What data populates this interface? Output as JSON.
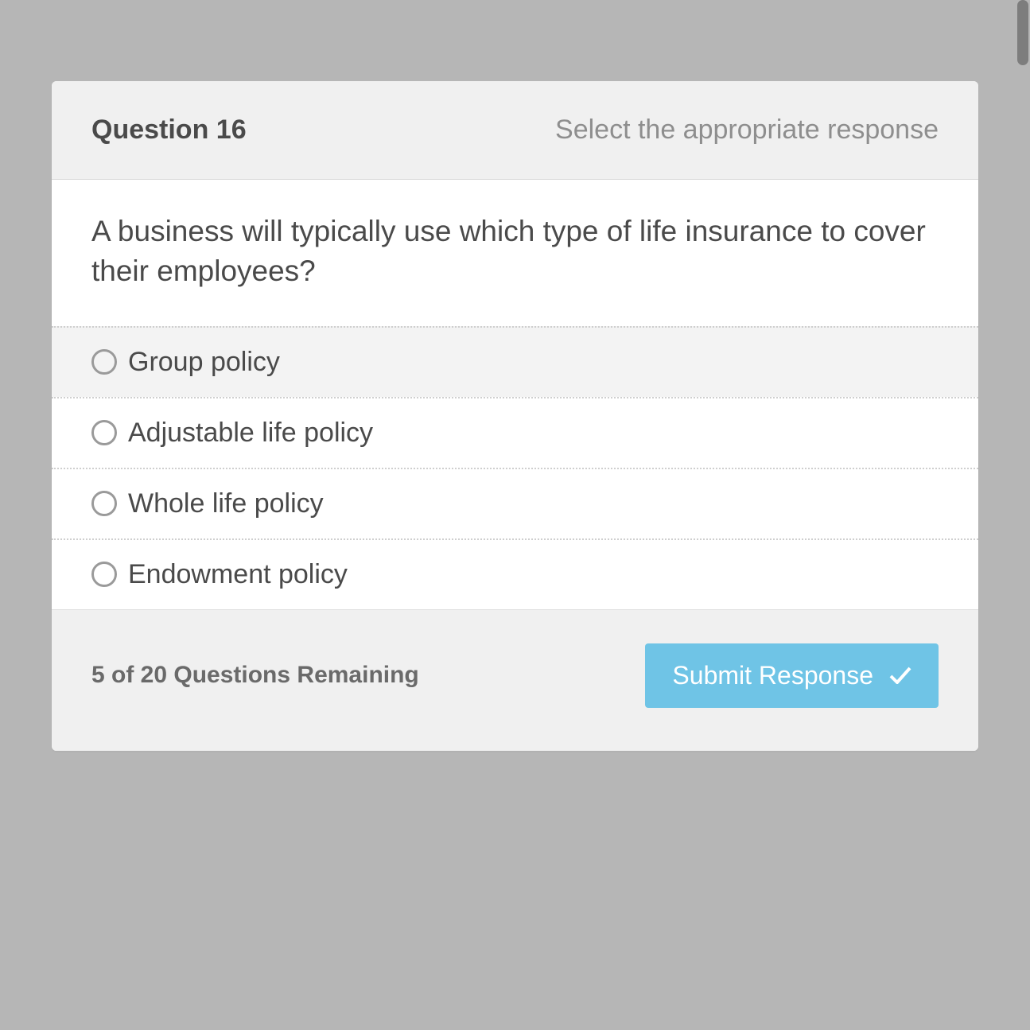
{
  "header": {
    "question_label": "Question 16",
    "instruction": "Select the appropriate response"
  },
  "question": {
    "text": "A business will typically use which type of life insurance to cover their employees?"
  },
  "options": [
    {
      "label": "Group policy",
      "selected": true
    },
    {
      "label": "Adjustable life policy",
      "selected": false
    },
    {
      "label": "Whole life policy",
      "selected": false
    },
    {
      "label": "Endowment policy",
      "selected": false
    }
  ],
  "footer": {
    "remaining": "5 of 20 Questions Remaining",
    "submit_label": "Submit Response"
  }
}
